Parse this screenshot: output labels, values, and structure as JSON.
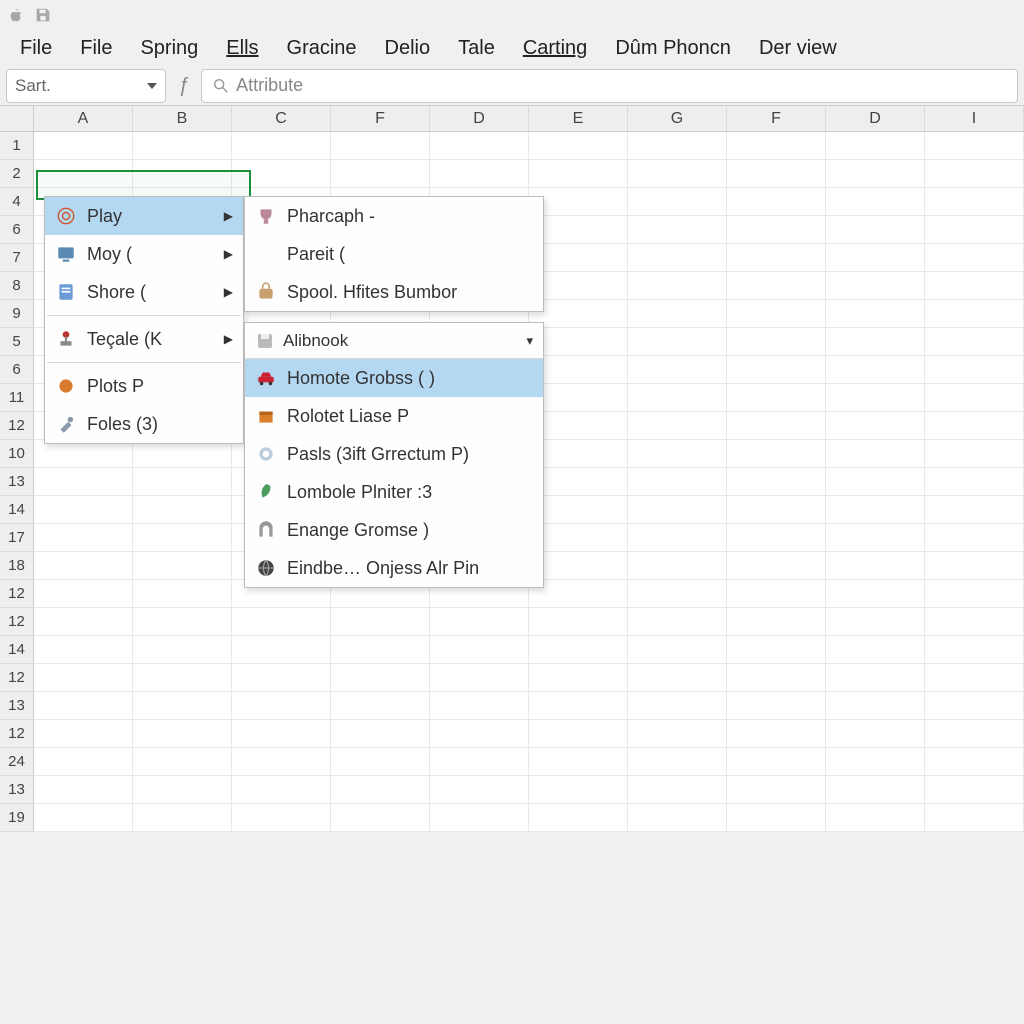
{
  "topIcons": [
    "apple-icon",
    "save-icon"
  ],
  "menuBar": [
    "File",
    "File",
    "Spring",
    "Ells",
    "Gracine",
    "Delio",
    "Tale",
    "Carting",
    "Dûm Phoncn",
    "Der view"
  ],
  "menuUnderlineIndex": {
    "3": 0,
    "7": 0
  },
  "nameBox": "Sart.",
  "fxLabel": "ƒ",
  "formulaPlaceholder": "Attribute",
  "columns": [
    "A",
    "B",
    "C",
    "F",
    "D",
    "E",
    "G",
    "F",
    "D",
    "I"
  ],
  "rowLabels": [
    "1",
    "2",
    "4",
    "6",
    "7",
    "8",
    "9",
    "5",
    "6",
    "11",
    "12",
    "10",
    "13",
    "14",
    "17",
    "18",
    "12",
    "12",
    "14",
    "12",
    "13",
    "12",
    "24",
    "13",
    "19"
  ],
  "contextMenu": {
    "items": [
      {
        "icon": "target-icon",
        "label": "Play",
        "hasSubmenu": true,
        "highlighted": true
      },
      {
        "icon": "screen-icon",
        "label": "Moy (",
        "hasSubmenu": true
      },
      {
        "icon": "doc-icon",
        "label": "Shore (",
        "hasSubmenu": true
      },
      {
        "sep": true
      },
      {
        "icon": "joystick-icon",
        "label": "Teçale (K",
        "hasSubmenu": true
      },
      {
        "sep": true
      },
      {
        "icon": "blob-icon",
        "label": "Plots P"
      },
      {
        "icon": "tool-icon",
        "label": "Foles (3)"
      }
    ]
  },
  "submenu1": {
    "items": [
      {
        "icon": "cup-icon",
        "label": "Pharcaph -"
      },
      {
        "icon": "",
        "label": "Pareit ("
      },
      {
        "icon": "bag-icon",
        "label": "Spool. Hfites Bumbor"
      }
    ]
  },
  "submenu2": {
    "header": {
      "icon": "disk-icon",
      "label": "Alibnook"
    },
    "items": [
      {
        "icon": "car-icon",
        "label": "Homote Grobss (  )",
        "highlighted": true
      },
      {
        "icon": "box-icon",
        "label": "Rolotet Liase P"
      },
      {
        "icon": "lens-icon",
        "label": "Pasls (3ift Grrectum P)"
      },
      {
        "icon": "leaf-icon",
        "label": "Lombole Plniter :3"
      },
      {
        "icon": "arch-icon",
        "label": "Enange Gromse )"
      },
      {
        "icon": "globe-icon",
        "label": "Eindbe… Onjess Alr Pin"
      }
    ]
  },
  "colors": {
    "highlight": "#b4d8f2",
    "selection": "#1a8f3c"
  }
}
